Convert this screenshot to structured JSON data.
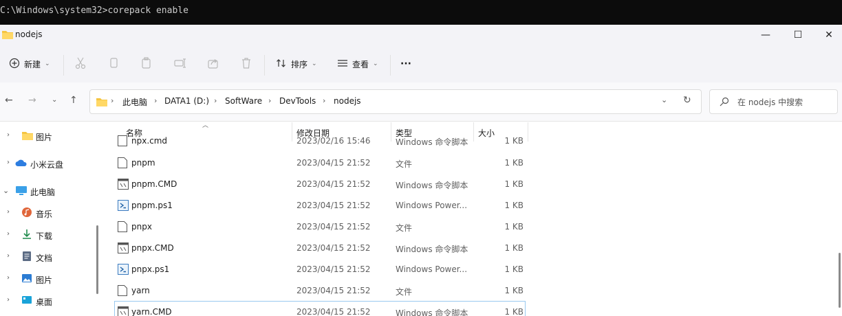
{
  "terminal": {
    "line": "C:\\Windows\\system32>corepack enable"
  },
  "window": {
    "title": "nodejs",
    "minimize": "—",
    "maximize": "☐",
    "close": "✕"
  },
  "toolbar": {
    "new_label": "新建",
    "sort_label": "排序",
    "view_label": "查看",
    "more_label": "···"
  },
  "address": {
    "crumbs": [
      "此电脑",
      "DATA1 (D:)",
      "SoftWare",
      "DevTools",
      "nodejs"
    ],
    "search_placeholder": "在 nodejs 中搜索"
  },
  "sidebar": {
    "items": [
      {
        "label": "图片",
        "icon": "folder-icon"
      },
      {
        "label": "小米云盘",
        "icon": "cloud-icon"
      },
      {
        "label": "此电脑",
        "icon": "computer-icon"
      },
      {
        "label": "音乐",
        "icon": "music-icon"
      },
      {
        "label": "下载",
        "icon": "download-icon"
      },
      {
        "label": "文档",
        "icon": "document-icon"
      },
      {
        "label": "图片",
        "icon": "pictures-icon"
      },
      {
        "label": "桌面",
        "icon": "desktop-icon"
      }
    ]
  },
  "columns": {
    "name": "名称",
    "date": "修改日期",
    "type": "类型",
    "size": "大小"
  },
  "files": [
    {
      "name": "npx.cmd",
      "date": "2023/02/16 15:46",
      "type": "Windows 命令脚本",
      "size": "1 KB",
      "icon": "cmd-file-icon"
    },
    {
      "name": "pnpm",
      "date": "2023/04/15 21:52",
      "type": "文件",
      "size": "1 KB",
      "icon": "file-icon"
    },
    {
      "name": "pnpm.CMD",
      "date": "2023/04/15 21:52",
      "type": "Windows 命令脚本",
      "size": "1 KB",
      "icon": "cmd-file-icon"
    },
    {
      "name": "pnpm.ps1",
      "date": "2023/04/15 21:52",
      "type": "Windows Power...",
      "size": "1 KB",
      "icon": "ps1-file-icon"
    },
    {
      "name": "pnpx",
      "date": "2023/04/15 21:52",
      "type": "文件",
      "size": "1 KB",
      "icon": "file-icon"
    },
    {
      "name": "pnpx.CMD",
      "date": "2023/04/15 21:52",
      "type": "Windows 命令脚本",
      "size": "1 KB",
      "icon": "cmd-file-icon"
    },
    {
      "name": "pnpx.ps1",
      "date": "2023/04/15 21:52",
      "type": "Windows Power...",
      "size": "1 KB",
      "icon": "ps1-file-icon"
    },
    {
      "name": "yarn",
      "date": "2023/04/15 21:52",
      "type": "文件",
      "size": "1 KB",
      "icon": "file-icon"
    },
    {
      "name": "yarn.CMD",
      "date": "2023/04/15 21:52",
      "type": "Windows 命令脚本",
      "size": "1 KB",
      "icon": "cmd-file-icon"
    }
  ],
  "colors": {
    "folder": "#f5c542",
    "accent": "#0067c0",
    "terminal_bg": "#0c0c0c"
  }
}
